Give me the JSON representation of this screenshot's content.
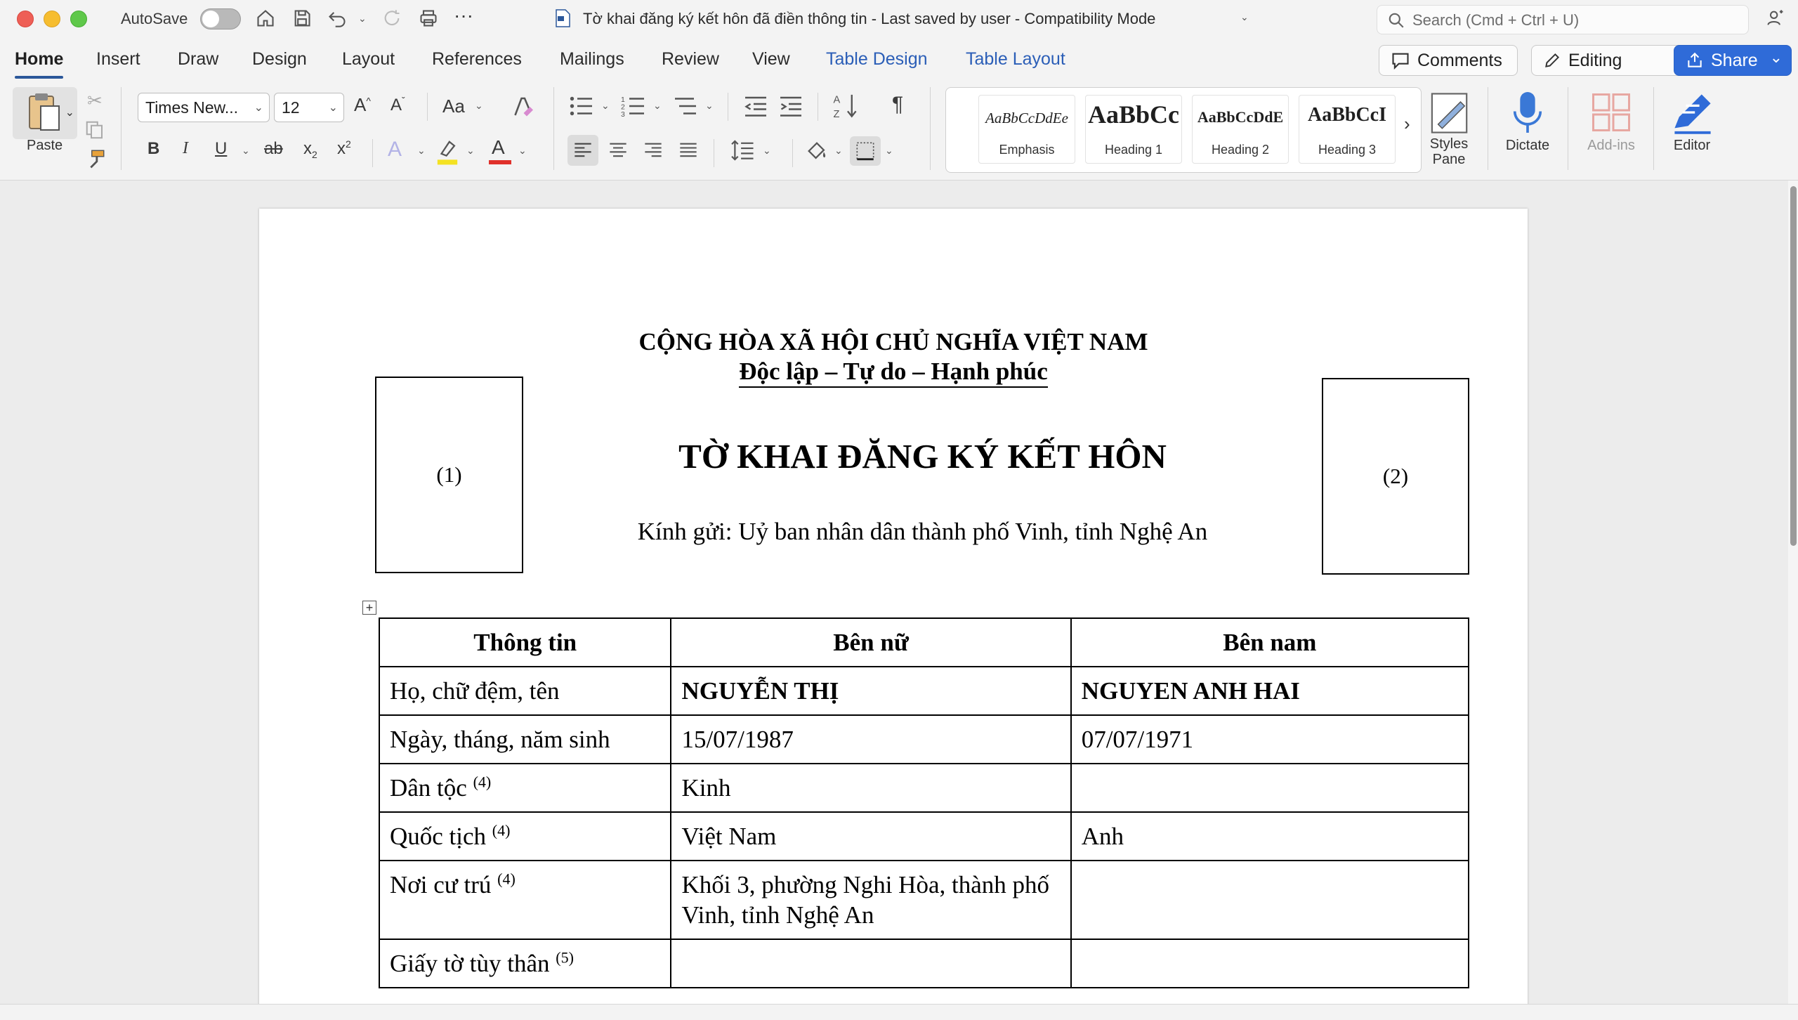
{
  "titlebar": {
    "autosave_label": "AutoSave",
    "document_title": "Tờ khai đăng ký kết hôn đã điền thông tin  -  Last saved by user  -  Compatibility Mode",
    "search_placeholder": "Search (Cmd + Ctrl + U)"
  },
  "tabs": [
    "Home",
    "Insert",
    "Draw",
    "Design",
    "Layout",
    "References",
    "Mailings",
    "Review",
    "View",
    "Table Design",
    "Table Layout"
  ],
  "actions": {
    "comments": "Comments",
    "editing": "Editing",
    "share": "Share"
  },
  "ribbon": {
    "paste": "Paste",
    "font_name": "Times New...",
    "font_size": "12",
    "styles": [
      {
        "preview": "AaBbCcDdEe",
        "name": "Emphasis"
      },
      {
        "preview": "AaBbCc",
        "name": "Heading 1"
      },
      {
        "preview": "AaBbCcDdE",
        "name": "Heading 2"
      },
      {
        "preview": "AaBbCcI",
        "name": "Heading 3"
      }
    ],
    "styles_pane": "Styles Pane",
    "dictate": "Dictate",
    "addins": "Add-ins",
    "editor": "Editor"
  },
  "document": {
    "national_title": "CỘNG HÒA XÃ HỘI CHỦ NGHĨA VIỆT NAM",
    "motto": "Độc lập – Tự do – Hạnh phúc",
    "form_title": "TỜ KHAI ĐĂNG KÝ KẾT HÔN",
    "addressee": "Kính gửi: Uỷ ban nhân dân thành phố Vinh, tỉnh Nghệ An",
    "photo_left": "(1)",
    "photo_right": "(2)",
    "table": {
      "headers": [
        "Thông tin",
        "Bên nữ",
        "Bên nam"
      ],
      "rows": [
        {
          "label": "Họ, chữ đệm, tên",
          "note": "",
          "female": "NGUYỄN THỊ",
          "male": "NGUYEN ANH HAI"
        },
        {
          "label": "Ngày, tháng, năm sinh",
          "note": "",
          "female": "15/07/1987",
          "male": "07/07/1971"
        },
        {
          "label": "Dân tộc",
          "note": "(4)",
          "female": "Kinh",
          "male": ""
        },
        {
          "label": "Quốc tịch",
          "note": "(4)",
          "female": "Việt Nam",
          "male": "Anh"
        },
        {
          "label": "Nơi cư trú",
          "note": "(4)",
          "female": "Khối 3, phường Nghi Hòa, thành phố Vinh, tỉnh Nghệ An",
          "male": ""
        },
        {
          "label": "Giấy tờ tùy thân",
          "note": "(5)",
          "female": "",
          "male": ""
        }
      ]
    }
  },
  "colors": {
    "accent_blue": "#2f6bd8",
    "tab_blue": "#2b5eb7",
    "close": "#ee5f56",
    "minimize": "#f6bd2f",
    "zoom": "#5fc84a"
  }
}
